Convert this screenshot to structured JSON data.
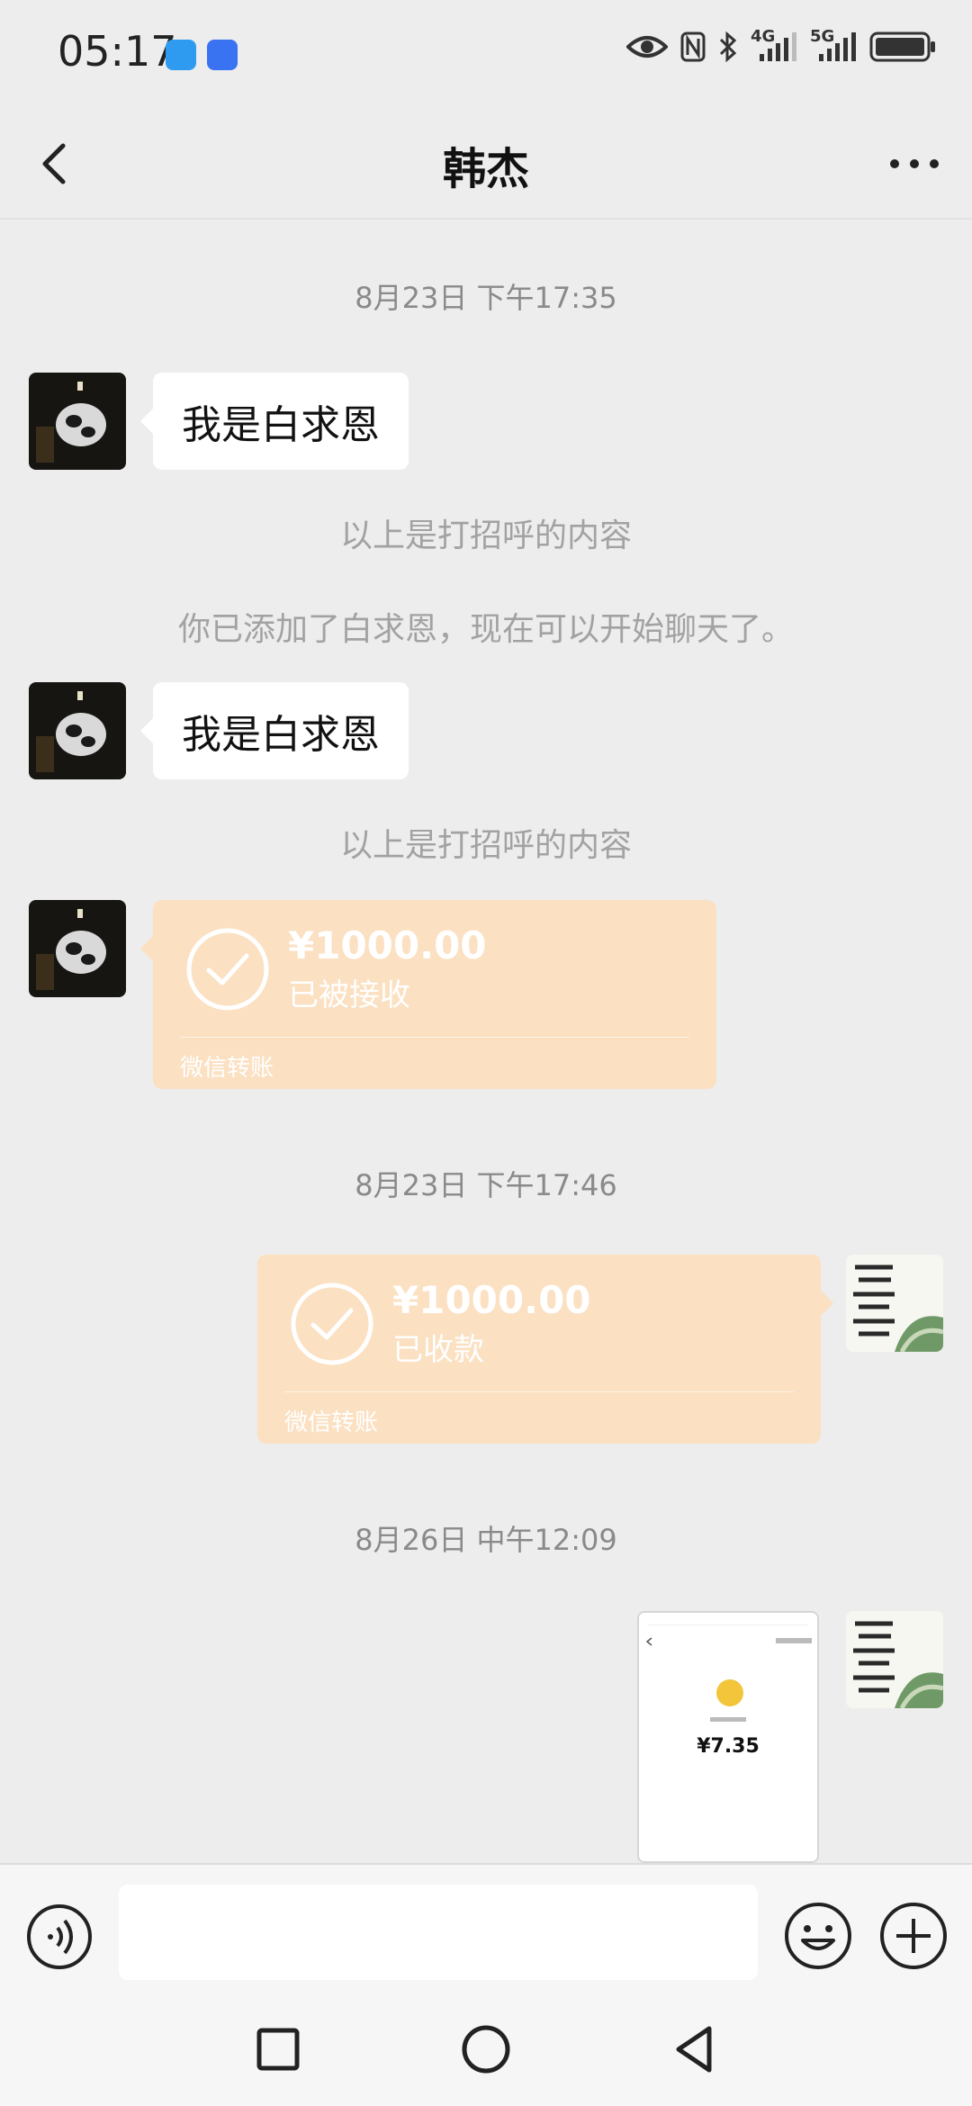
{
  "status_bar": {
    "time": "05:17",
    "icons": [
      "message-app-icon",
      "voice-app-icon",
      "eye-icon",
      "nfc-icon",
      "bluetooth-icon",
      "signal-4g-icon",
      "signal-5g-icon",
      "battery-icon"
    ],
    "signal_4g_label": "4G",
    "signal_5g_label": "5G"
  },
  "header": {
    "title": "韩杰",
    "back_icon": "chevron-left-icon",
    "more_icon": "more-dots-icon"
  },
  "messages": {
    "ts1": "8月23日 下午17:35",
    "greet1": "我是白求恩",
    "sys1": "以上是打招呼的内容",
    "sys2": "你已添加了白求恩，现在可以开始聊天了。",
    "greet2": "我是白求恩",
    "sys3": "以上是打招呼的内容",
    "transfer1": {
      "amount": "¥1000.00",
      "status": "已被接收",
      "type": "微信转账"
    },
    "ts2": "8月23日 下午17:46",
    "transfer2": {
      "amount": "¥1000.00",
      "status": "已收款",
      "type": "微信转账"
    },
    "ts3": "8月26日 中午12:09",
    "image_msg": {
      "amount": "¥7.35"
    }
  },
  "input_bar": {
    "voice_icon": "voice-input-icon",
    "emoji_icon": "emoji-icon",
    "plus_icon": "plus-circle-icon",
    "value": ""
  },
  "nav_bar": {
    "icons": [
      "recent-apps-icon",
      "home-icon",
      "back-icon"
    ]
  },
  "colors": {
    "background": "#ededed",
    "transfer_bg": "#fbe0c2",
    "bubble_bg": "#ffffff",
    "timestamp": "#8a8a8a"
  }
}
